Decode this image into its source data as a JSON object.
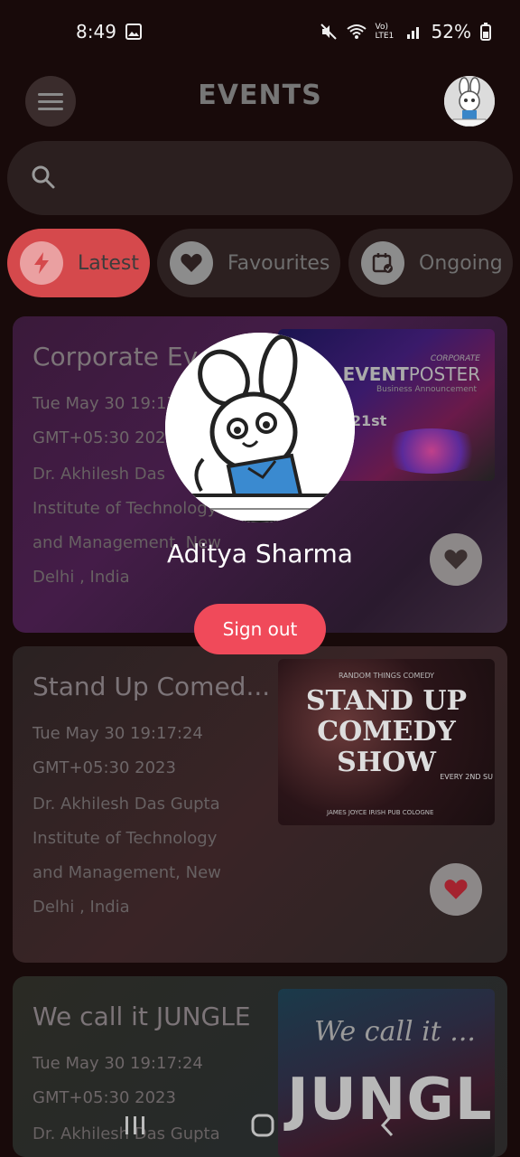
{
  "status_bar": {
    "time": "8:49",
    "battery": "52%",
    "network_label": "Vo) LTE1"
  },
  "header": {
    "title": "EVENTS"
  },
  "search": {
    "placeholder": ""
  },
  "chips": [
    {
      "label": "Latest",
      "icon": "bolt-icon",
      "active": true
    },
    {
      "label": "Favourites",
      "icon": "heart-icon",
      "active": false
    },
    {
      "label": "Ongoing",
      "icon": "calendar-check-icon",
      "active": false
    }
  ],
  "cards": [
    {
      "title": "Corporate Ev",
      "date_line1": "Tue May 30 19:17",
      "date_line2": "GMT+05:30 2023",
      "location": [
        "Dr. Akhilesh Das",
        "Institute of Technology",
        "and Management, New",
        "Delhi , India"
      ],
      "image_text": {
        "top": "CORPORATE",
        "main_a": "EVENT",
        "main_b": "POSTER",
        "sub": "Business Announcement",
        "date": "ER 21st"
      },
      "favourite": false
    },
    {
      "title": "Stand Up Comed...",
      "date_line1": "Tue May 30 19:17:24",
      "date_line2": "GMT+05:30 2023",
      "location": [
        "Dr. Akhilesh Das Gupta",
        "Institute of Technology",
        "and Management, New",
        "Delhi , India"
      ],
      "image_text": {
        "top": "RANDOM THINGS COMEDY",
        "line1": "STAND UP",
        "line2": "COMEDY",
        "line3": "SHOW",
        "side": "EVERY 2ND SU",
        "bottom": "JAMES JOYCE IRISH PUB COLOGNE"
      },
      "favourite": true
    },
    {
      "title": "We call it JUNGLE",
      "date_line1": "Tue May 30 19:17:24",
      "date_line2": "GMT+05:30 2023",
      "location": [
        "Dr. Akhilesh Das Gupta"
      ],
      "image_text": {
        "script": "We call it ...",
        "big": "JUNGLE"
      },
      "favourite": false
    }
  ],
  "profile_overlay": {
    "name": "Aditya Sharma",
    "signout_label": "Sign out"
  },
  "colors": {
    "accent": "#f04a5a",
    "chip_active": "#d5494c",
    "background": "#180a0a"
  }
}
